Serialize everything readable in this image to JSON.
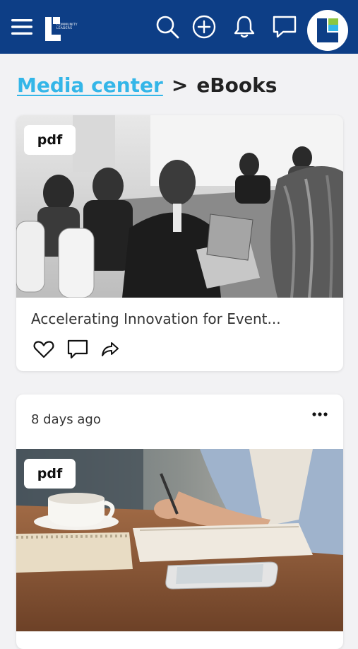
{
  "header": {
    "logo_text": "COMMUNITY LEADERS",
    "brand_color": "#0d3e86",
    "icons": [
      "menu-icon",
      "search-icon",
      "add-icon",
      "bell-icon",
      "chat-icon"
    ]
  },
  "breadcrumb": {
    "parent": "Media center",
    "separator": ">",
    "current": "eBooks",
    "link_color": "#34b6e8"
  },
  "cards": [
    {
      "badge": "pdf",
      "title": "Accelerating Innovation for Event...",
      "actions": [
        "heart-icon",
        "comment-icon",
        "share-icon"
      ]
    },
    {
      "date": "8 days ago",
      "badge": "pdf"
    }
  ]
}
